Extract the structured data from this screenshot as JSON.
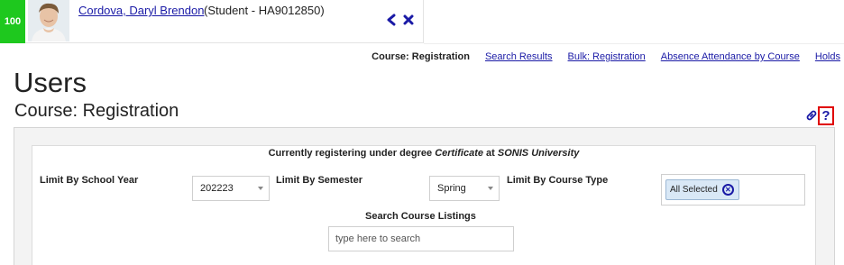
{
  "student": {
    "score": "100",
    "name": "Cordova, Daryl Brendon",
    "meta": "(Student - HA9012850)"
  },
  "nav_links": {
    "current": "Course: Registration",
    "items": [
      "Search Results",
      "Bulk: Registration",
      "Absence Attendance by Course",
      "Holds"
    ]
  },
  "page": {
    "title": "Users",
    "subtitle": "Course: Registration"
  },
  "registration": {
    "prefix": "Currently registering under degree ",
    "degree": "Certificate",
    "middle": " at ",
    "school": "SONIS University"
  },
  "filters": {
    "school_year_label": "Limit By School Year",
    "school_year_value": "202223",
    "semester_label": "Limit By Semester",
    "semester_value": "Spring",
    "course_type_label": "Limit By Course Type",
    "course_type_value": "All Selected"
  },
  "search": {
    "label": "Search Course Listings",
    "placeholder": "type here to search",
    "value": ""
  },
  "colors": {
    "score_badge": "#1ec81e",
    "link": "#1a1aa6",
    "help_highlight": "#e00000"
  },
  "icons": {
    "prev": "chevron-left-icon",
    "close": "close-icon",
    "link": "link-icon",
    "help": "help-icon",
    "chip_remove": "circle-x-icon"
  }
}
